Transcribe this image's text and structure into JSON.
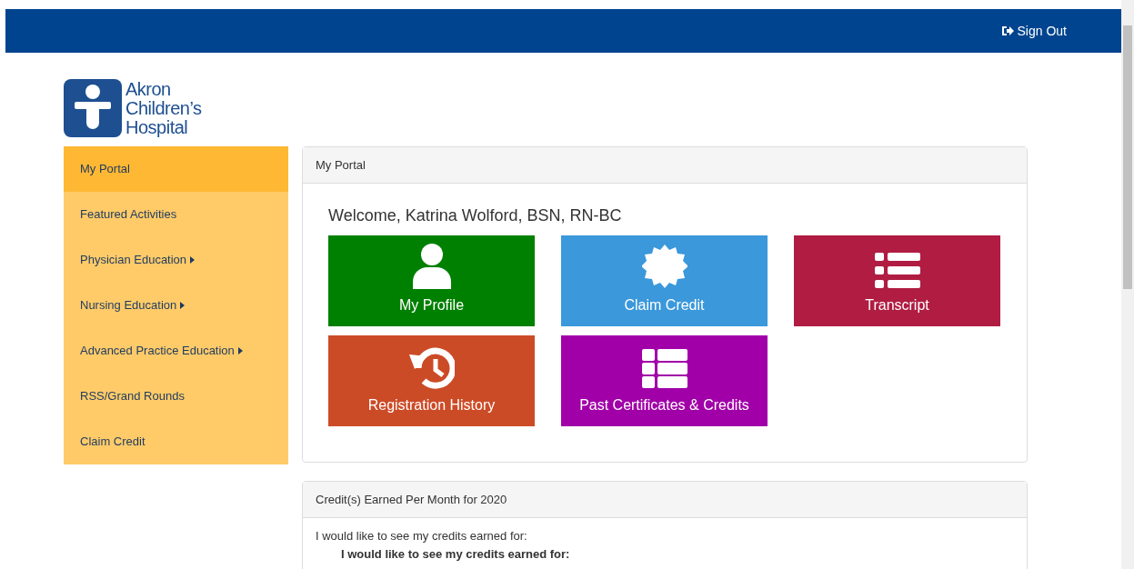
{
  "header": {
    "sign_out": "Sign Out"
  },
  "logo": {
    "lines": [
      "Akron",
      "Children’s",
      "Hospital"
    ]
  },
  "sidebar": {
    "items": [
      {
        "label": "My Portal",
        "selected": true,
        "submenu": false
      },
      {
        "label": "Featured Activities",
        "selected": false,
        "submenu": false
      },
      {
        "label": "Physician Education",
        "selected": false,
        "submenu": true
      },
      {
        "label": "Nursing Education",
        "selected": false,
        "submenu": true
      },
      {
        "label": "Advanced Practice Education",
        "selected": false,
        "submenu": true
      },
      {
        "label": "RSS/Grand Rounds",
        "selected": false,
        "submenu": false
      },
      {
        "label": "Claim Credit",
        "selected": false,
        "submenu": false
      }
    ]
  },
  "portal_panel": {
    "title": "My Portal",
    "welcome": "Welcome, Katrina Wolford, BSN, RN-BC",
    "tiles": [
      {
        "label": "My Profile",
        "color": "#008000",
        "kind": "person"
      },
      {
        "label": "Claim Credit",
        "color": "#3a98db",
        "kind": "badge"
      },
      {
        "label": "Transcript",
        "color": "#b01c42",
        "kind": "list"
      },
      {
        "label": "Registration History",
        "color": "#cc4b27",
        "kind": "history"
      },
      {
        "label": "Past Certificates & Credits",
        "color": "#a100a8",
        "kind": "table"
      }
    ]
  },
  "credits_panel": {
    "title": "Credit(s) Earned Per Month for 2020",
    "intro": "I would like to see my credits earned for:",
    "subheading": "I would like to see my credits earned for:"
  }
}
